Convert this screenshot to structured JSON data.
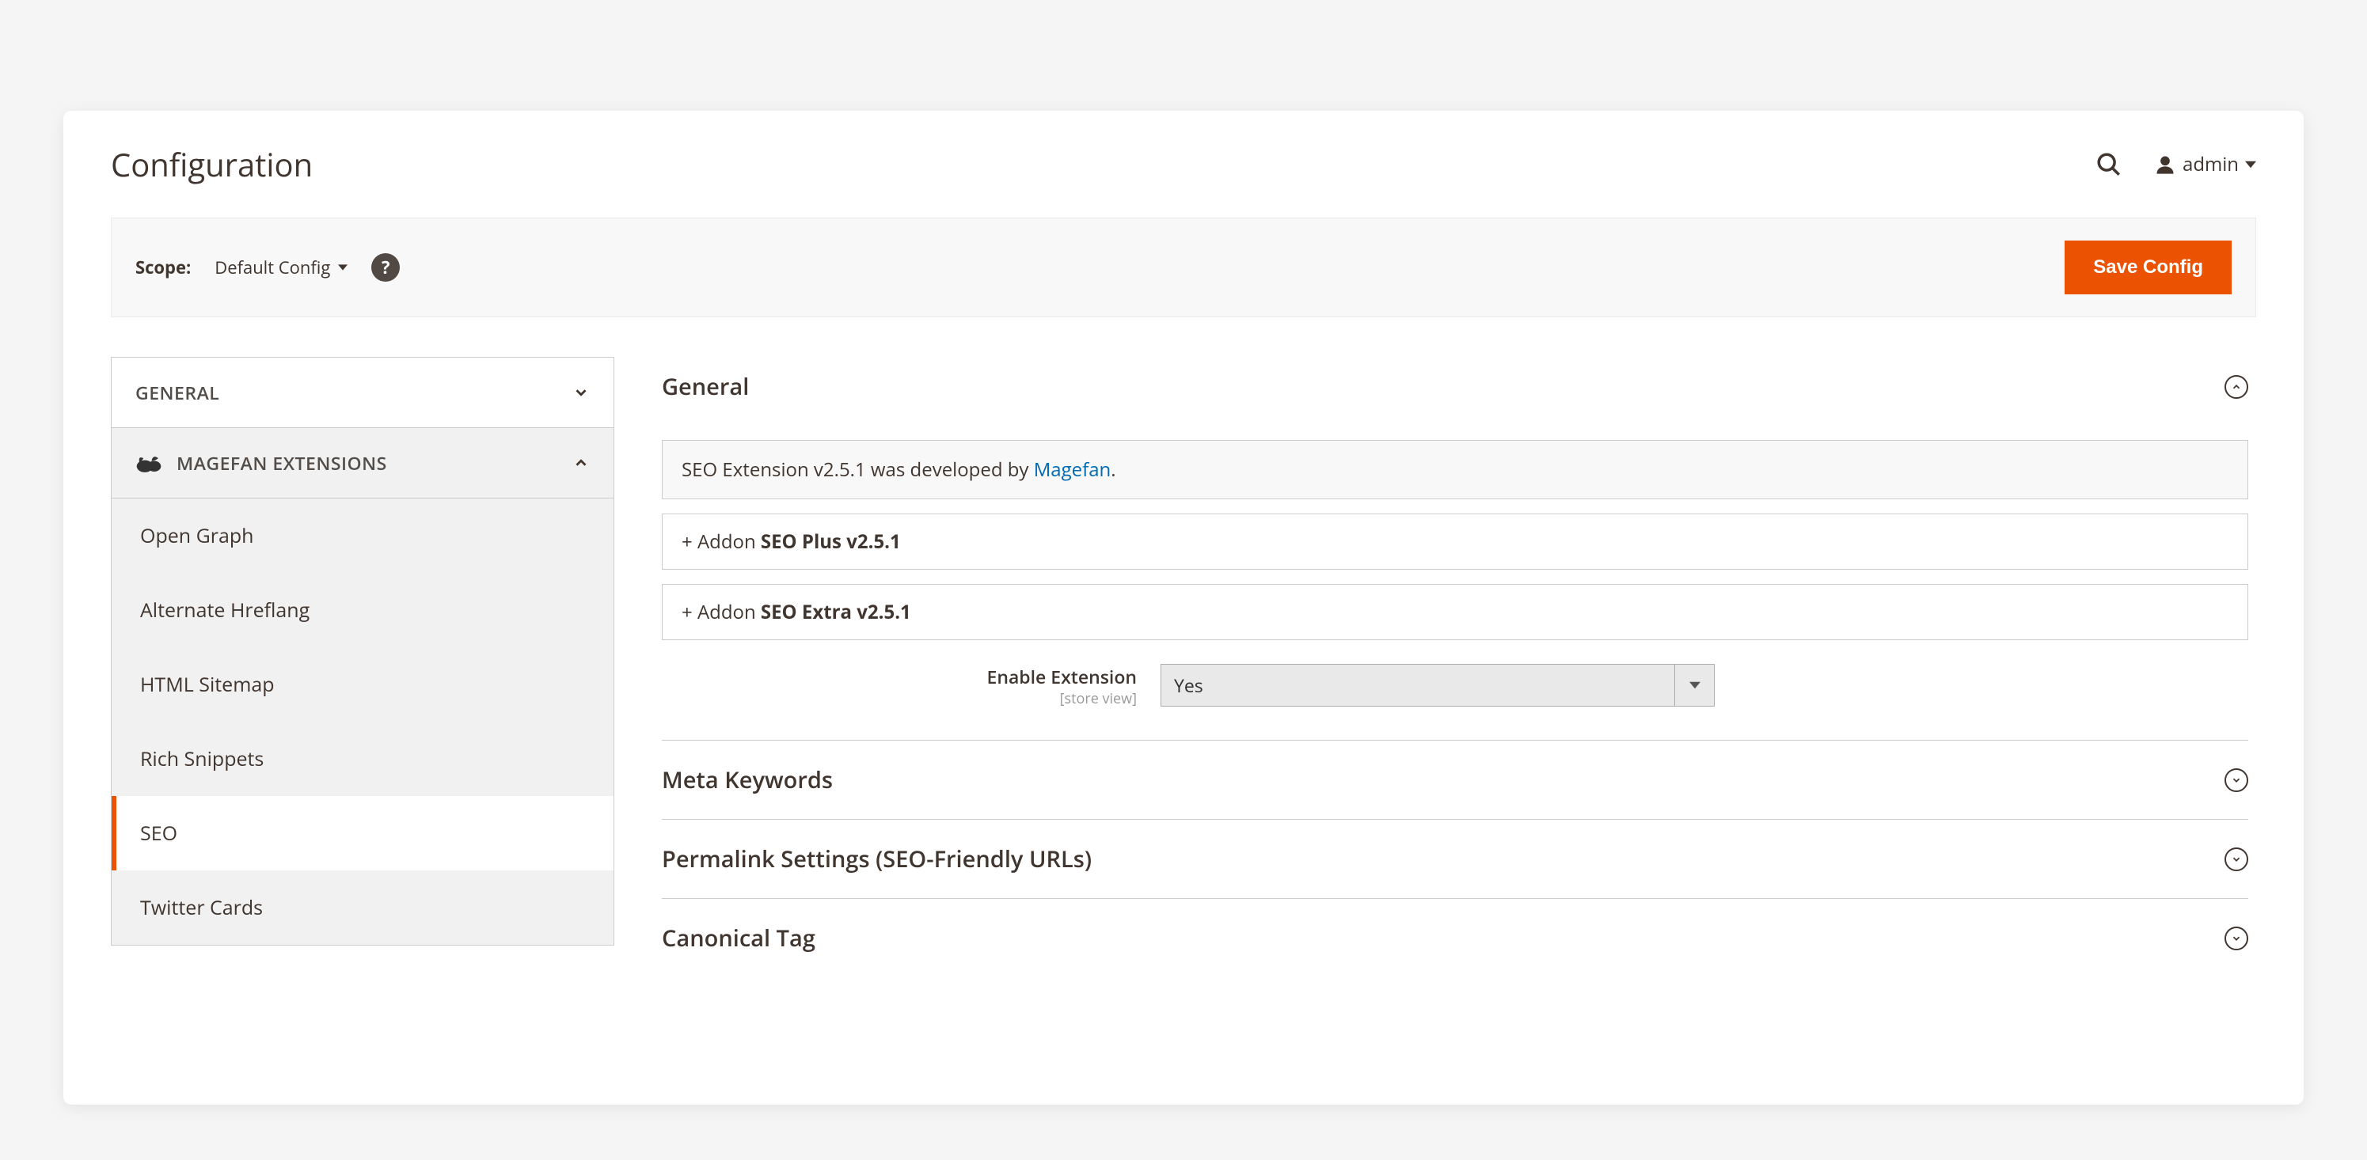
{
  "page": {
    "title": "Configuration",
    "user": "admin"
  },
  "scope": {
    "label": "Scope:",
    "value": "Default Config"
  },
  "buttons": {
    "save": "Save Config"
  },
  "sidebar": {
    "tabs": [
      {
        "label": "GENERAL"
      },
      {
        "label": "MAGEFAN EXTENSIONS"
      }
    ],
    "items": [
      {
        "label": "Open Graph"
      },
      {
        "label": "Alternate Hreflang"
      },
      {
        "label": "HTML Sitemap"
      },
      {
        "label": "Rich Snippets"
      },
      {
        "label": "SEO"
      },
      {
        "label": "Twitter Cards"
      }
    ]
  },
  "sections": {
    "general": {
      "title": "General",
      "info_prefix": "SEO Extension v2.5.1 was developed by ",
      "info_link": "Magefan",
      "info_suffix": ".",
      "addon1_prefix": "+ Addon ",
      "addon1_name": "SEO Plus v2.5.1",
      "addon2_prefix": "+ Addon ",
      "addon2_name": "SEO Extra v2.5.1",
      "enable_label": "Enable Extension",
      "enable_scope": "[store view]",
      "enable_value": "Yes"
    },
    "collapsed": [
      {
        "title": "Meta Keywords"
      },
      {
        "title": "Permalink Settings (SEO-Friendly URLs)"
      },
      {
        "title": "Canonical Tag"
      }
    ]
  }
}
